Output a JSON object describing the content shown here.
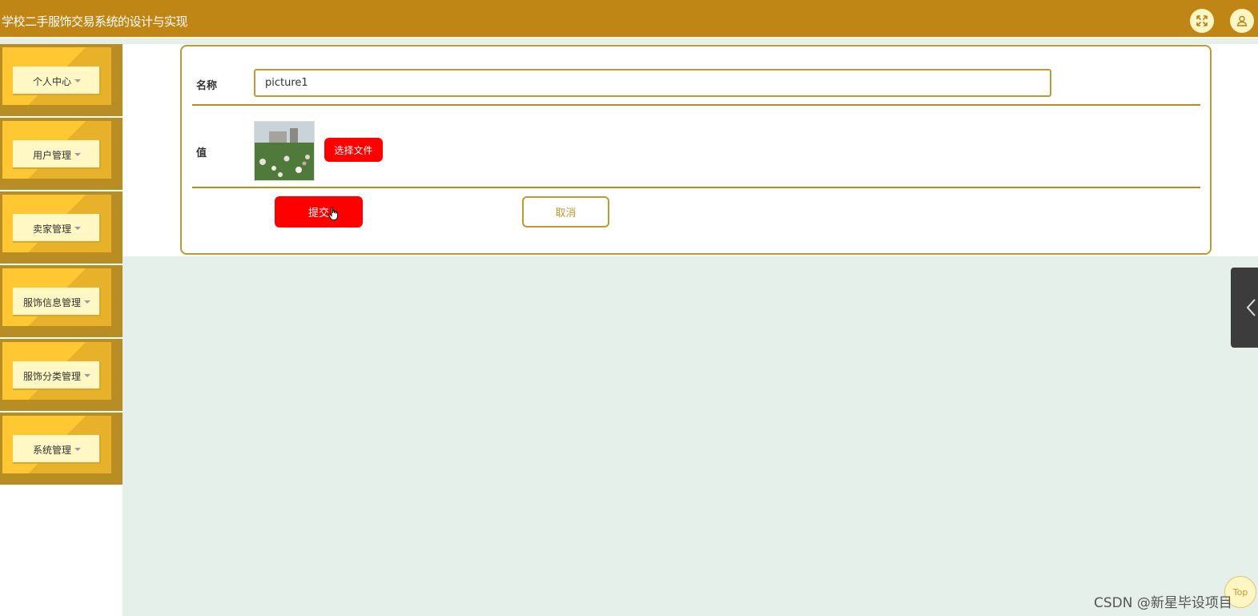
{
  "app": {
    "title": "学校二手服饰交易系统的设计与实现"
  },
  "header": {
    "fullscreen_icon": "expand-icon",
    "user_icon": "user-icon"
  },
  "sidebar": {
    "items": [
      {
        "label": "个人中心"
      },
      {
        "label": "用户管理"
      },
      {
        "label": "卖家管理"
      },
      {
        "label": "服饰信息管理"
      },
      {
        "label": "服饰分类管理"
      },
      {
        "label": "系统管理"
      }
    ]
  },
  "form": {
    "name_label": "名称",
    "name_value": "picture1",
    "value_label": "值",
    "choose_file_label": "选择文件",
    "submit_label": "提交",
    "cancel_label": "取消"
  },
  "colors": {
    "brand": "#bf8616",
    "accent_red": "#ff0000",
    "border_gold": "#c09a30"
  },
  "misc": {
    "top_label": "Top",
    "watermark": "CSDN @新星毕设项目"
  }
}
